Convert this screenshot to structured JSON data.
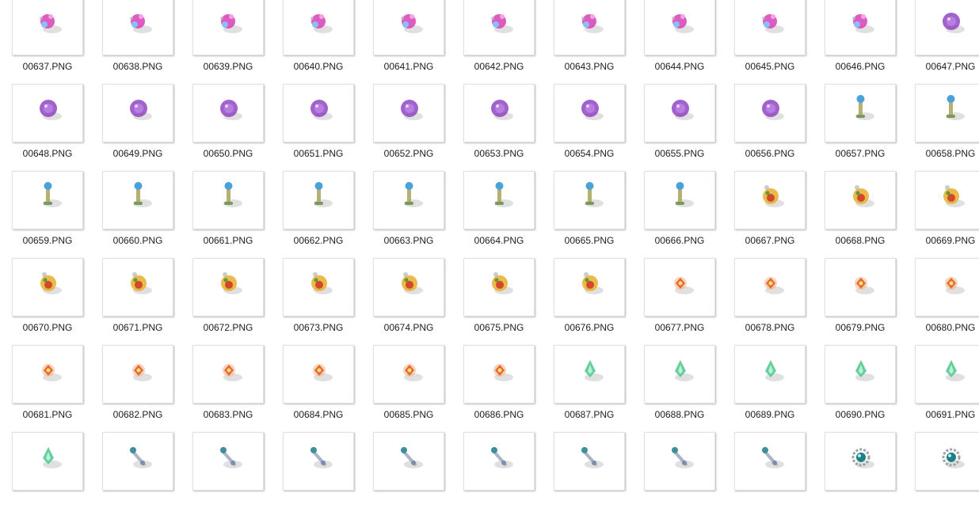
{
  "window": {
    "view": "large-icons",
    "background": "#ffffff"
  },
  "files": [
    {
      "name": "00637.PNG",
      "icon": "magenta-crystal-burst-icon",
      "color": "#d63fb6"
    },
    {
      "name": "00638.PNG",
      "icon": "magenta-crystal-burst-icon",
      "color": "#d63fb6"
    },
    {
      "name": "00639.PNG",
      "icon": "magenta-crystal-burst-icon",
      "color": "#d63fb6"
    },
    {
      "name": "00640.PNG",
      "icon": "magenta-crystal-burst-icon",
      "color": "#d63fb6"
    },
    {
      "name": "00641.PNG",
      "icon": "magenta-crystal-burst-icon",
      "color": "#d63fb6"
    },
    {
      "name": "00642.PNG",
      "icon": "magenta-crystal-burst-icon",
      "color": "#d63fb6"
    },
    {
      "name": "00643.PNG",
      "icon": "magenta-crystal-burst-icon",
      "color": "#d63fb6"
    },
    {
      "name": "00644.PNG",
      "icon": "magenta-crystal-burst-icon",
      "color": "#d63fb6"
    },
    {
      "name": "00645.PNG",
      "icon": "magenta-crystal-burst-icon",
      "color": "#d63fb6"
    },
    {
      "name": "00646.PNG",
      "icon": "magenta-crystal-burst-icon",
      "color": "#d63fb6"
    },
    {
      "name": "00647.PNG",
      "icon": "purple-orb-icon",
      "color": "#8a3bbf"
    },
    {
      "name": "00648.PNG",
      "icon": "purple-orb-icon",
      "color": "#8a3bbf"
    },
    {
      "name": "00649.PNG",
      "icon": "purple-orb-icon",
      "color": "#8a3bbf"
    },
    {
      "name": "00650.PNG",
      "icon": "purple-orb-icon",
      "color": "#8a3bbf"
    },
    {
      "name": "00651.PNG",
      "icon": "purple-orb-icon",
      "color": "#8a3bbf"
    },
    {
      "name": "00652.PNG",
      "icon": "purple-orb-icon",
      "color": "#8a3bbf"
    },
    {
      "name": "00653.PNG",
      "icon": "purple-orb-icon",
      "color": "#8a3bbf"
    },
    {
      "name": "00654.PNG",
      "icon": "purple-orb-icon",
      "color": "#8a3bbf"
    },
    {
      "name": "00655.PNG",
      "icon": "purple-orb-icon",
      "color": "#8a3bbf"
    },
    {
      "name": "00656.PNG",
      "icon": "purple-orb-icon",
      "color": "#8a3bbf"
    },
    {
      "name": "00657.PNG",
      "icon": "blue-flame-torch-icon",
      "color": "#4aa3d8"
    },
    {
      "name": "00658.PNG",
      "icon": "blue-flame-torch-icon",
      "color": "#4aa3d8"
    },
    {
      "name": "00659.PNG",
      "icon": "blue-flame-torch-icon",
      "color": "#4aa3d8"
    },
    {
      "name": "00660.PNG",
      "icon": "blue-flame-torch-icon",
      "color": "#4aa3d8"
    },
    {
      "name": "00661.PNG",
      "icon": "blue-flame-torch-icon",
      "color": "#4aa3d8"
    },
    {
      "name": "00662.PNG",
      "icon": "blue-flame-torch-icon",
      "color": "#4aa3d8"
    },
    {
      "name": "00663.PNG",
      "icon": "blue-flame-torch-icon",
      "color": "#4aa3d8"
    },
    {
      "name": "00664.PNG",
      "icon": "blue-flame-torch-icon",
      "color": "#4aa3d8"
    },
    {
      "name": "00665.PNG",
      "icon": "blue-flame-torch-icon",
      "color": "#4aa3d8"
    },
    {
      "name": "00666.PNG",
      "icon": "blue-flame-torch-icon",
      "color": "#4aa3d8"
    },
    {
      "name": "00667.PNG",
      "icon": "red-gold-ornament-icon",
      "color": "#d04a2a"
    },
    {
      "name": "00668.PNG",
      "icon": "red-gold-ornament-icon",
      "color": "#d04a2a"
    },
    {
      "name": "00669.PNG",
      "icon": "red-gold-ornament-icon",
      "color": "#d04a2a"
    },
    {
      "name": "00670.PNG",
      "icon": "red-gold-ornament-icon",
      "color": "#d04a2a"
    },
    {
      "name": "00671.PNG",
      "icon": "red-gold-ornament-icon",
      "color": "#d04a2a"
    },
    {
      "name": "00672.PNG",
      "icon": "red-gold-ornament-icon",
      "color": "#d04a2a"
    },
    {
      "name": "00673.PNG",
      "icon": "red-gold-ornament-icon",
      "color": "#d04a2a"
    },
    {
      "name": "00674.PNG",
      "icon": "red-gold-ornament-icon",
      "color": "#d04a2a"
    },
    {
      "name": "00675.PNG",
      "icon": "red-gold-ornament-icon",
      "color": "#d04a2a"
    },
    {
      "name": "00676.PNG",
      "icon": "red-gold-ornament-icon",
      "color": "#d04a2a"
    },
    {
      "name": "00677.PNG",
      "icon": "orange-spark-icon",
      "color": "#e86a2a"
    },
    {
      "name": "00678.PNG",
      "icon": "orange-spark-icon",
      "color": "#e86a2a"
    },
    {
      "name": "00679.PNG",
      "icon": "orange-spark-icon",
      "color": "#e86a2a"
    },
    {
      "name": "00680.PNG",
      "icon": "orange-spark-icon",
      "color": "#e86a2a"
    },
    {
      "name": "00681.PNG",
      "icon": "orange-spark-icon",
      "color": "#e86a2a"
    },
    {
      "name": "00682.PNG",
      "icon": "orange-spark-icon",
      "color": "#e86a2a"
    },
    {
      "name": "00683.PNG",
      "icon": "orange-spark-icon",
      "color": "#e86a2a"
    },
    {
      "name": "00684.PNG",
      "icon": "orange-spark-icon",
      "color": "#e86a2a"
    },
    {
      "name": "00685.PNG",
      "icon": "orange-spark-icon",
      "color": "#e86a2a"
    },
    {
      "name": "00686.PNG",
      "icon": "orange-spark-icon",
      "color": "#e86a2a"
    },
    {
      "name": "00687.PNG",
      "icon": "green-crystal-flame-icon",
      "color": "#4cc58e"
    },
    {
      "name": "00688.PNG",
      "icon": "green-crystal-flame-icon",
      "color": "#4cc58e"
    },
    {
      "name": "00689.PNG",
      "icon": "green-crystal-flame-icon",
      "color": "#4cc58e"
    },
    {
      "name": "00690.PNG",
      "icon": "green-crystal-flame-icon",
      "color": "#4cc58e"
    },
    {
      "name": "00691.PNG",
      "icon": "green-crystal-flame-icon",
      "color": "#4cc58e"
    },
    {
      "name": "",
      "icon": "green-crystal-flame-icon",
      "color": "#4cc58e"
    },
    {
      "name": "",
      "icon": "teal-debris-icon",
      "color": "#3f8f9a"
    },
    {
      "name": "",
      "icon": "teal-debris-icon",
      "color": "#3f8f9a"
    },
    {
      "name": "",
      "icon": "teal-debris-icon",
      "color": "#3f8f9a"
    },
    {
      "name": "",
      "icon": "teal-debris-icon",
      "color": "#3f8f9a"
    },
    {
      "name": "",
      "icon": "teal-debris-icon",
      "color": "#3f8f9a"
    },
    {
      "name": "",
      "icon": "teal-debris-icon",
      "color": "#3f8f9a"
    },
    {
      "name": "",
      "icon": "teal-debris-icon",
      "color": "#3f8f9a"
    },
    {
      "name": "",
      "icon": "teal-debris-icon",
      "color": "#3f8f9a"
    },
    {
      "name": "",
      "icon": "teal-gear-orb-icon",
      "color": "#1f7f86"
    },
    {
      "name": "",
      "icon": "teal-gear-orb-icon",
      "color": "#1f7f86"
    }
  ]
}
